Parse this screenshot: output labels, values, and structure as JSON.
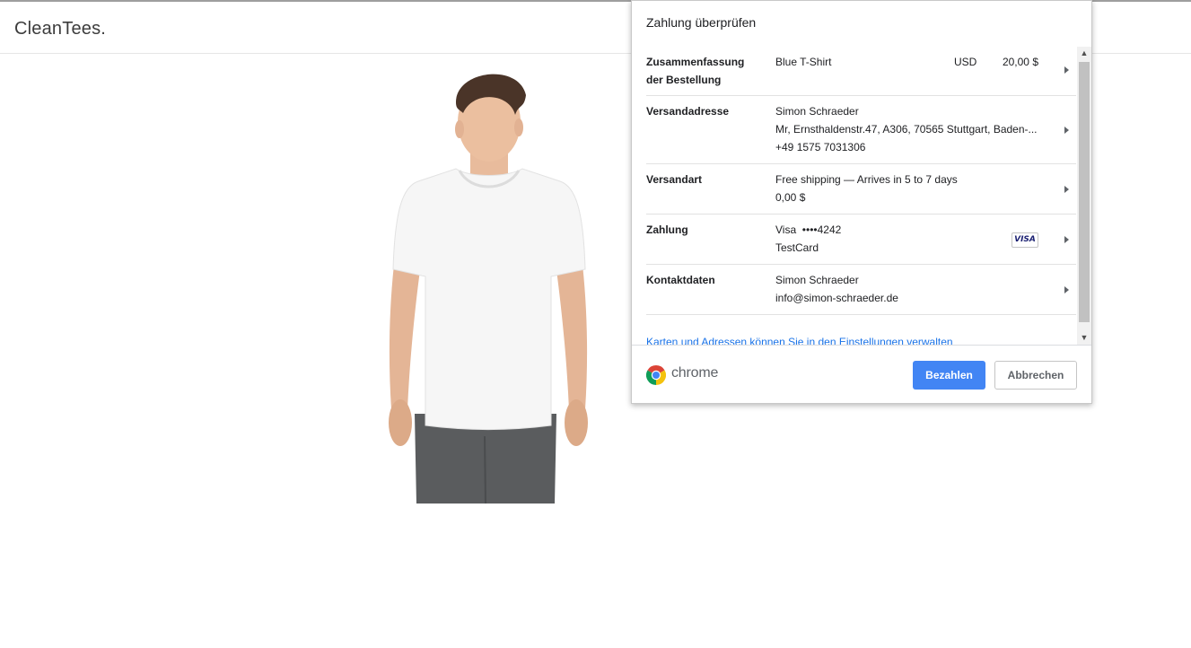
{
  "site": {
    "brand": "CleanTees."
  },
  "product": {
    "image_alt": "Person wearing a white t-shirt"
  },
  "dialog": {
    "title": "Zahlung überprüfen",
    "rows": {
      "summary": {
        "label_line1": "Zusammenfassung",
        "label_line2": "der Bestellung",
        "item": "Blue T-Shirt",
        "currency": "USD",
        "amount": "20,00 $"
      },
      "shipping_address": {
        "label": "Versandadresse",
        "name": "Simon Schraeder",
        "address": "Mr, Ernsthaldenstr.47, A306, 70565 Stuttgart, Baden-...",
        "phone": "+49 1575 7031306"
      },
      "shipping_option": {
        "label": "Versandart",
        "option": "Free shipping — Arrives in 5 to 7 days",
        "price": "0,00 $"
      },
      "payment": {
        "label": "Zahlung",
        "card": "Visa  ••••4242",
        "cardholder": "TestCard",
        "badge": "VISA"
      },
      "contact": {
        "label": "Kontaktdaten",
        "name": "Simon Schraeder",
        "email": "info@simon-schraeder.de"
      }
    },
    "manage_link": "Karten und Adressen können Sie in den Einstellungen verwalten",
    "footer": {
      "browser_name": "chrome",
      "pay_label": "Bezahlen",
      "cancel_label": "Abbrechen"
    },
    "colors": {
      "primary_button": "#4285f4",
      "link": "#1a73e8"
    }
  }
}
